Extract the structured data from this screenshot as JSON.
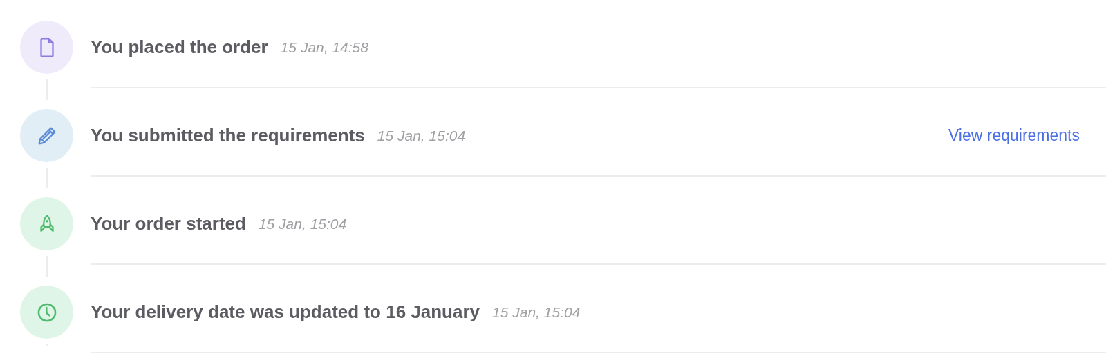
{
  "timeline": [
    {
      "kind": "document",
      "title": "You placed the order",
      "time": "15 Jan, 14:58"
    },
    {
      "kind": "pencil",
      "title": "You submitted the requirements",
      "time": "15 Jan, 15:04",
      "link": "View requirements"
    },
    {
      "kind": "rocket",
      "title": "Your order started",
      "time": "15 Jan, 15:04"
    },
    {
      "kind": "clock",
      "title": "Your delivery date was updated to 16 January",
      "time": "15 Jan, 15:04"
    }
  ]
}
